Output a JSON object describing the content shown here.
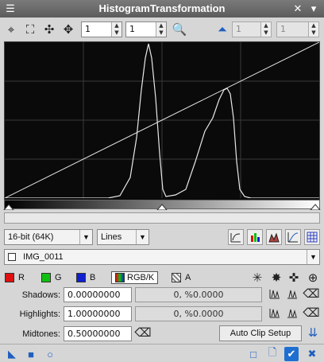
{
  "window": {
    "title": "HistogramTransformation"
  },
  "toolbar": {
    "zoom_h": "1",
    "zoom_v": "1",
    "spin_a": "1",
    "spin_b": "1"
  },
  "controls": {
    "bit_depth": "16-bit (64K)",
    "graph_style": "Lines",
    "view": "IMG_0011"
  },
  "channels": {
    "r": "R",
    "g": "G",
    "b": "B",
    "rgbk": "RGB/K",
    "a": "A"
  },
  "params": {
    "shadows_label": "Shadows:",
    "shadows_value": "0.00000000",
    "shadows_readout": "0, %0.0000",
    "highlights_label": "Highlights:",
    "highlights_value": "1.00000000",
    "highlights_readout": "0, %0.0000",
    "midtones_label": "Midtones:",
    "midtones_value": "0.50000000",
    "auto_clip": "Auto Clip Setup"
  },
  "colors": {
    "accent": "#1f6fd0",
    "red": "#e01010",
    "green": "#10c010",
    "blue": "#1020d0"
  }
}
